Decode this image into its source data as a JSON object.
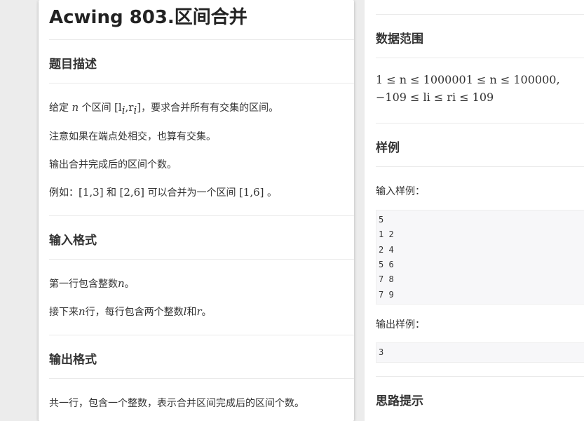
{
  "title": "Acwing 803.区间合并",
  "left": {
    "desc_heading": "题目描述",
    "desc_line1_pre": "给定",
    "desc_line1_n": "n",
    "desc_line1_mid": "个区间",
    "desc_line1_interval": "[l",
    "desc_line1_interval_sub_l": "i",
    "desc_line1_interval_comma": ",r",
    "desc_line1_interval_sub_r": "i",
    "desc_line1_interval_end": "]",
    "desc_line1_post": "，要求合并所有有交集的区间。",
    "desc_line2": "注意如果在端点处相交，也算有交集。",
    "desc_line3": "输出合并完成后的区间个数。",
    "desc_line4_pre": "例如：",
    "desc_line4_a": "[1,3]",
    "desc_line4_and": "和",
    "desc_line4_b": "[2,6]",
    "desc_line4_mid": "可以合并为一个区间",
    "desc_line4_c": "[1,6]",
    "desc_line4_end": "。",
    "input_heading": "输入格式",
    "input_line1_pre": "第一行包含整数",
    "input_line1_n": "n",
    "input_line1_end": "。",
    "input_line2_pre": "接下来",
    "input_line2_n": "n",
    "input_line2_mid": "行，每行包含两个整数",
    "input_line2_l": "l",
    "input_line2_and": "和",
    "input_line2_r": "r",
    "input_line2_end": "。",
    "output_heading": "输出格式",
    "output_line1": "共一行，包含一个整数，表示合并区间完成后的区间个数。"
  },
  "right": {
    "range_heading": "数据范围",
    "range_line1": "1 ≤ n ≤ 1000001 ≤ n ≤ 100000,",
    "range_line2": "−109 ≤ li ≤ ri ≤ 109",
    "sample_heading": "样例",
    "input_sample_label": "输入样例：",
    "input_sample_lines": [
      "5",
      "1 2",
      "2 4",
      "5 6",
      "7 8",
      "7 9"
    ],
    "output_sample_label": "输出样例：",
    "output_sample_lines": [
      "3"
    ],
    "hint_heading": "思路提示"
  }
}
